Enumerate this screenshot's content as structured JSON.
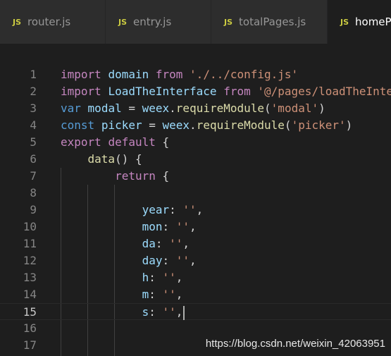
{
  "tabs": [
    {
      "icon": "JS",
      "label": "router.js",
      "active": false
    },
    {
      "icon": "JS",
      "label": "entry.js",
      "active": false
    },
    {
      "icon": "JS",
      "label": "totalPages.js",
      "active": false
    },
    {
      "icon": "JS",
      "label": "homeP",
      "active": true
    }
  ],
  "editor": {
    "current_line": 15,
    "lines": [
      {
        "num": "1",
        "tokens": [
          {
            "t": "import",
            "c": "kw"
          },
          {
            "t": " ",
            "c": "pl"
          },
          {
            "t": "domain",
            "c": "vr"
          },
          {
            "t": " ",
            "c": "pl"
          },
          {
            "t": "from",
            "c": "kw"
          },
          {
            "t": " ",
            "c": "pl"
          },
          {
            "t": "'./../config.js'",
            "c": "st"
          }
        ]
      },
      {
        "num": "2",
        "tokens": [
          {
            "t": "import",
            "c": "kw"
          },
          {
            "t": " ",
            "c": "pl"
          },
          {
            "t": "LoadTheInterface",
            "c": "vr"
          },
          {
            "t": " ",
            "c": "pl"
          },
          {
            "t": "from",
            "c": "kw"
          },
          {
            "t": " ",
            "c": "pl"
          },
          {
            "t": "'@/pages/loadTheInte",
            "c": "st"
          }
        ]
      },
      {
        "num": "3",
        "tokens": [
          {
            "t": "var",
            "c": "kb"
          },
          {
            "t": " ",
            "c": "pl"
          },
          {
            "t": "modal",
            "c": "vr"
          },
          {
            "t": " = ",
            "c": "pl"
          },
          {
            "t": "weex",
            "c": "vr"
          },
          {
            "t": ".",
            "c": "pl"
          },
          {
            "t": "requireModule",
            "c": "fn"
          },
          {
            "t": "(",
            "c": "pl"
          },
          {
            "t": "'modal'",
            "c": "st"
          },
          {
            "t": ")",
            "c": "pl"
          }
        ]
      },
      {
        "num": "4",
        "tokens": [
          {
            "t": "const",
            "c": "kb"
          },
          {
            "t": " ",
            "c": "pl"
          },
          {
            "t": "picker",
            "c": "vr"
          },
          {
            "t": " = ",
            "c": "pl"
          },
          {
            "t": "weex",
            "c": "vr"
          },
          {
            "t": ".",
            "c": "pl"
          },
          {
            "t": "requireModule",
            "c": "fn"
          },
          {
            "t": "(",
            "c": "pl"
          },
          {
            "t": "'picker'",
            "c": "st"
          },
          {
            "t": ")",
            "c": "pl"
          }
        ]
      },
      {
        "num": "5",
        "tokens": [
          {
            "t": "export",
            "c": "kw"
          },
          {
            "t": " ",
            "c": "pl"
          },
          {
            "t": "default",
            "c": "kw"
          },
          {
            "t": " {",
            "c": "pl"
          }
        ]
      },
      {
        "num": "6",
        "tokens": [
          {
            "t": "    ",
            "c": "pl"
          },
          {
            "t": "data",
            "c": "fn"
          },
          {
            "t": "() {",
            "c": "pl"
          }
        ]
      },
      {
        "num": "7",
        "tokens": [
          {
            "t": "        ",
            "c": "pl"
          },
          {
            "t": "return",
            "c": "kw"
          },
          {
            "t": " {",
            "c": "pl"
          }
        ]
      },
      {
        "num": "8",
        "tokens": []
      },
      {
        "num": "9",
        "tokens": [
          {
            "t": "            ",
            "c": "pl"
          },
          {
            "t": "year",
            "c": "vr"
          },
          {
            "t": ": ",
            "c": "pl"
          },
          {
            "t": "''",
            "c": "st"
          },
          {
            "t": ",",
            "c": "pl"
          }
        ]
      },
      {
        "num": "10",
        "tokens": [
          {
            "t": "            ",
            "c": "pl"
          },
          {
            "t": "mon",
            "c": "vr"
          },
          {
            "t": ": ",
            "c": "pl"
          },
          {
            "t": "''",
            "c": "st"
          },
          {
            "t": ",",
            "c": "pl"
          }
        ]
      },
      {
        "num": "11",
        "tokens": [
          {
            "t": "            ",
            "c": "pl"
          },
          {
            "t": "da",
            "c": "vr"
          },
          {
            "t": ": ",
            "c": "pl"
          },
          {
            "t": "''",
            "c": "st"
          },
          {
            "t": ",",
            "c": "pl"
          }
        ]
      },
      {
        "num": "12",
        "tokens": [
          {
            "t": "            ",
            "c": "pl"
          },
          {
            "t": "day",
            "c": "vr"
          },
          {
            "t": ": ",
            "c": "pl"
          },
          {
            "t": "''",
            "c": "st"
          },
          {
            "t": ",",
            "c": "pl"
          }
        ]
      },
      {
        "num": "13",
        "tokens": [
          {
            "t": "            ",
            "c": "pl"
          },
          {
            "t": "h",
            "c": "vr"
          },
          {
            "t": ": ",
            "c": "pl"
          },
          {
            "t": "''",
            "c": "st"
          },
          {
            "t": ",",
            "c": "pl"
          }
        ]
      },
      {
        "num": "14",
        "tokens": [
          {
            "t": "            ",
            "c": "pl"
          },
          {
            "t": "m",
            "c": "vr"
          },
          {
            "t": ": ",
            "c": "pl"
          },
          {
            "t": "''",
            "c": "st"
          },
          {
            "t": ",",
            "c": "pl"
          }
        ]
      },
      {
        "num": "15",
        "tokens": [
          {
            "t": "            ",
            "c": "pl"
          },
          {
            "t": "s",
            "c": "vr"
          },
          {
            "t": ": ",
            "c": "pl"
          },
          {
            "t": "''",
            "c": "st"
          },
          {
            "t": ",",
            "c": "pl"
          }
        ]
      },
      {
        "num": "16",
        "tokens": []
      },
      {
        "num": "17",
        "tokens": []
      }
    ]
  },
  "watermark": "https://blog.csdn.net/weixin_42063951",
  "colors": {
    "background": "#1e1e1e",
    "tab_bar": "#252526",
    "keyword": "#c586c0",
    "string": "#ce9178",
    "variable": "#9cdcfe",
    "function": "#dcdcaa",
    "declaration": "#569cd6",
    "js_badge": "#cbcb41"
  }
}
